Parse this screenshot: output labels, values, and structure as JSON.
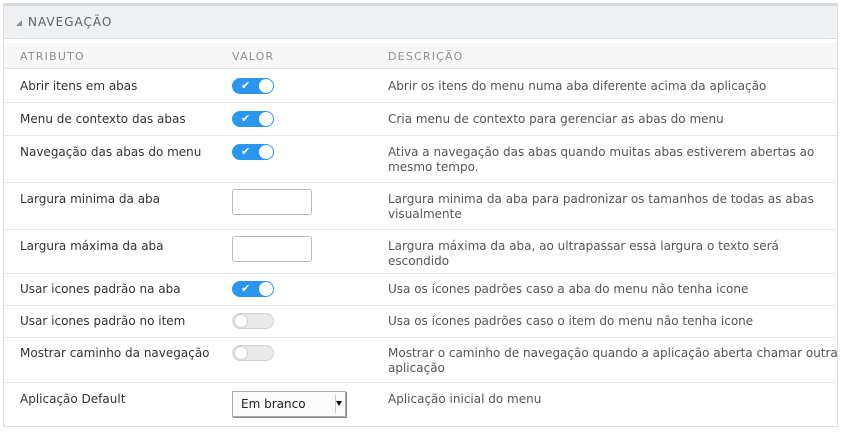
{
  "section": {
    "title": "NAVEGAÇÃO"
  },
  "columns": {
    "attr": "ATRIBUTO",
    "value": "VALOR",
    "desc": "DESCRIÇÃO"
  },
  "rows": [
    {
      "label": "Abrir itens em abas",
      "desc": "Abrir os itens do menu numa aba diferente acima da aplicação",
      "control": "toggle",
      "state": "on"
    },
    {
      "label": "Menu de contexto das abas",
      "desc": "Cria menu de contexto para gerenciar as abas do menu",
      "control": "toggle",
      "state": "on"
    },
    {
      "label": "Navegação das abas do menu",
      "desc": "Ativa a navegação das abas quando muitas abas estiverem abertas ao mesmo tempo.",
      "control": "toggle",
      "state": "on"
    },
    {
      "label": "Largura minima da aba",
      "desc": "Largura minima da aba para padronizar os tamanhos de todas as abas visualmente",
      "control": "text",
      "value": ""
    },
    {
      "label": "Largura máxima da aba",
      "desc": "Largura máxima da aba, ao ultrapassar essa largura o texto será escondido",
      "control": "text",
      "value": ""
    },
    {
      "label": "Usar icones padrão na aba",
      "desc": "Usa os ícones padrões caso a aba do menu não tenha icone",
      "control": "toggle",
      "state": "on"
    },
    {
      "label": "Usar icones padrão no item",
      "desc": "Usa os ícones padrões caso o item do menu não tenha icone",
      "control": "toggle",
      "state": "off"
    },
    {
      "label": "Mostrar caminho da navegação",
      "desc": "Mostrar o caminho de navegação quando a aplicação aberta chamar outra aplicação",
      "control": "toggle",
      "state": "off"
    },
    {
      "label": "Aplicação Default",
      "desc": "Aplicação inicial do menu",
      "control": "select",
      "value": "Em branco"
    }
  ],
  "icons": {
    "collapse": "caret-collapse-icon",
    "check": "checkmark-icon",
    "dropdown": "dropdown-arrow-icon"
  },
  "colors": {
    "toggle_on": "#2a96f0",
    "toggle_off": "#e9e9e9",
    "header_bg": "#eef0f2"
  }
}
